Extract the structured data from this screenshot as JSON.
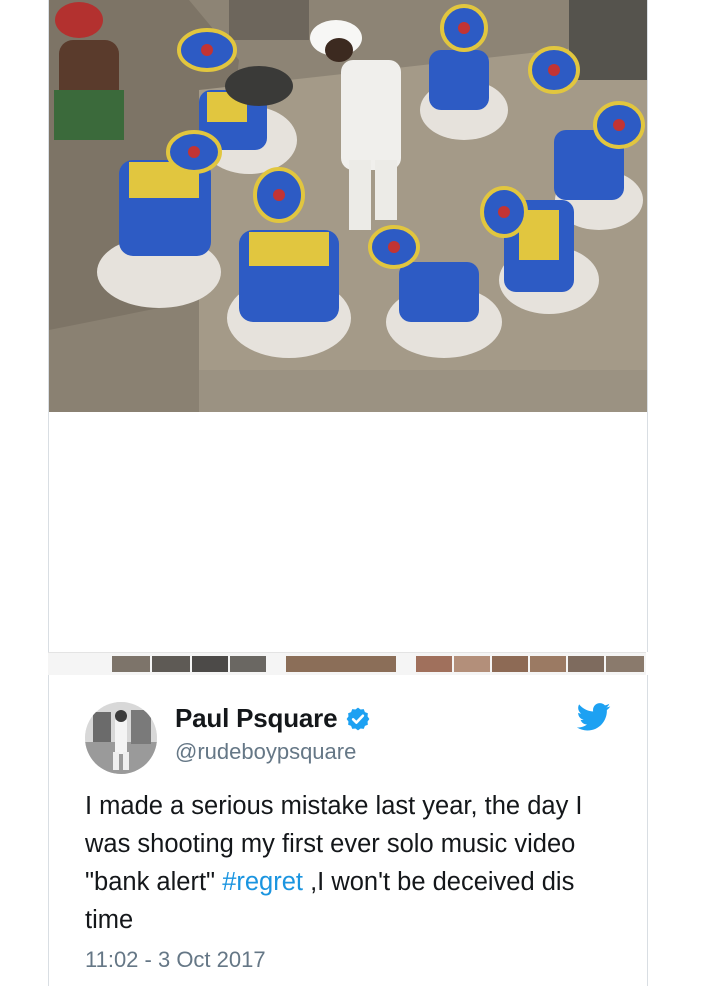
{
  "media": {
    "photo_alt": "photo-dancers",
    "thumb_count": 15
  },
  "tweet": {
    "display_name": "Paul Psquare",
    "handle": "@rudeboypsquare",
    "verified_icon": "verified-badge-icon",
    "platform_icon": "twitter-bird-icon",
    "text_before": "I made a serious mistake last year, the day I was shooting my first ever solo music video \"bank alert\" ",
    "hashtag": "#regret",
    "text_after": " ,I won't be deceived dis time",
    "timestamp": "11:02 - 3 Oct 2017"
  },
  "colors": {
    "text": "#14171a",
    "secondary": "#657786",
    "link": "#1b95e0",
    "verified": "#1da1f2",
    "border": "#d9dee3"
  }
}
